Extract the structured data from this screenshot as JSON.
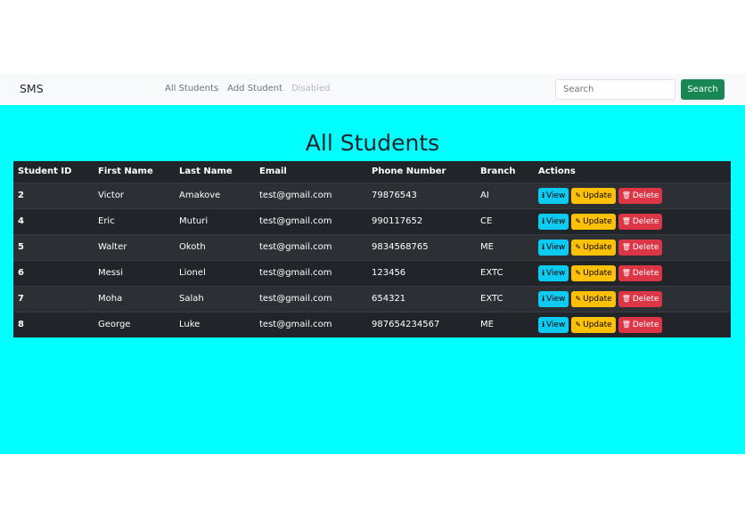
{
  "navbar": {
    "brand": "SMS",
    "links": [
      {
        "label": "All Students"
      },
      {
        "label": "Add Student"
      },
      {
        "label": "Disabled"
      }
    ],
    "search": {
      "placeholder": "Search",
      "button_label": "Search"
    }
  },
  "main": {
    "title": "All Students",
    "columns": [
      "Student ID",
      "First Name",
      "Last Name",
      "Email",
      "Phone Number",
      "Branch",
      "Actions"
    ],
    "action_labels": {
      "view": "View",
      "update": "Update",
      "delete": "Delete"
    },
    "rows": [
      {
        "id": "2",
        "first": "Victor",
        "last": "Amakove",
        "email": "test@gmail.com",
        "phone": "79876543",
        "branch": "AI"
      },
      {
        "id": "4",
        "first": "Eric",
        "last": "Muturi",
        "email": "test@gmail.com",
        "phone": "990117652",
        "branch": "CE"
      },
      {
        "id": "5",
        "first": "Walter",
        "last": "Okoth",
        "email": "test@gmail.com",
        "phone": "9834568765",
        "branch": "ME"
      },
      {
        "id": "6",
        "first": "Messi",
        "last": "Lionel",
        "email": "test@gmail.com",
        "phone": "123456",
        "branch": "EXTC"
      },
      {
        "id": "7",
        "first": "Moha",
        "last": "Salah",
        "email": "test@gmail.com",
        "phone": "654321",
        "branch": "EXTC"
      },
      {
        "id": "8",
        "first": "George",
        "last": "Luke",
        "email": "test@gmail.com",
        "phone": "987654234567",
        "branch": "ME"
      }
    ]
  },
  "colors": {
    "main_bg": "#00ffff",
    "table_bg": "#212529",
    "search_btn": "#198754",
    "view": "#0dcaf0",
    "update": "#ffc107",
    "delete": "#dc3545"
  }
}
